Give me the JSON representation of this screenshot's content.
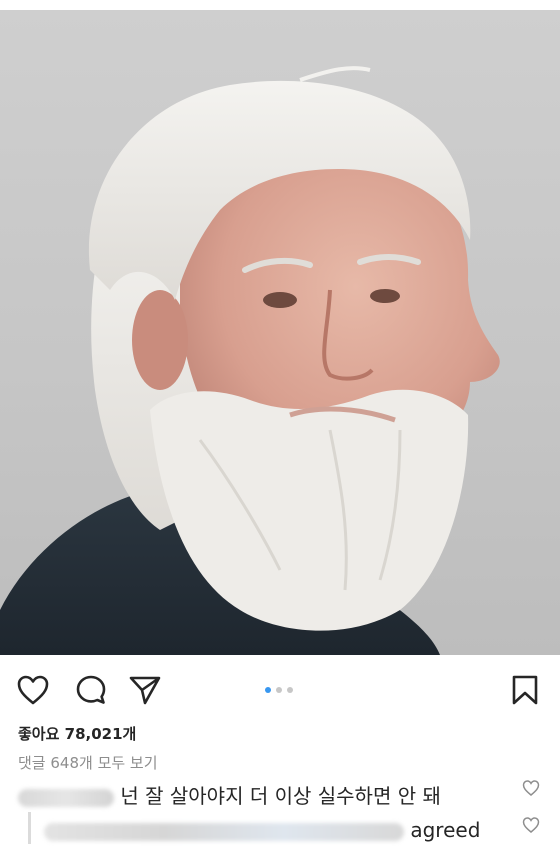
{
  "post": {
    "image_alt": "elderly man with white hair and beard in profile, grey background",
    "carousel": {
      "count": 3,
      "active": 1
    }
  },
  "actions": {
    "like_icon": "heart-outline-icon",
    "comment_icon": "speech-bubble-icon",
    "share_icon": "paper-plane-icon",
    "save_icon": "bookmark-icon"
  },
  "likes": {
    "label": "좋아요",
    "count": "78,021개"
  },
  "comments": {
    "view_all": "댓글 648개 모두 보기",
    "items": [
      {
        "text": "넌 잘 살아야지 더 이상 실수하면 안 돼"
      },
      {
        "text": "agreed"
      }
    ]
  },
  "colors": {
    "accent": "#3897f0",
    "text": "#262626",
    "muted": "#8e8e8e"
  }
}
